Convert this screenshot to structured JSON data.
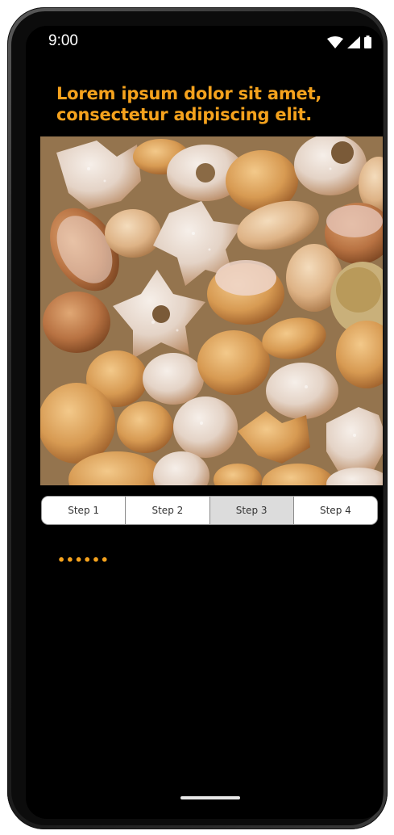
{
  "status_bar": {
    "time": "9:00",
    "icons": [
      "wifi-icon",
      "cellular-signal-icon",
      "battery-icon"
    ]
  },
  "headline": "Lorem ipsum dolor sit amet, consectetur adipiscing elit.",
  "photo": {
    "subject": "pastry-photo"
  },
  "steps": {
    "items": [
      "Step 1",
      "Step 2",
      "Step 3",
      "Step 4"
    ],
    "selected": "Step 3"
  },
  "progress_dots": "••••••",
  "colors": {
    "accent": "#f5a21d",
    "screen_background": "#000000",
    "selected_step": "#dcdcdc"
  }
}
